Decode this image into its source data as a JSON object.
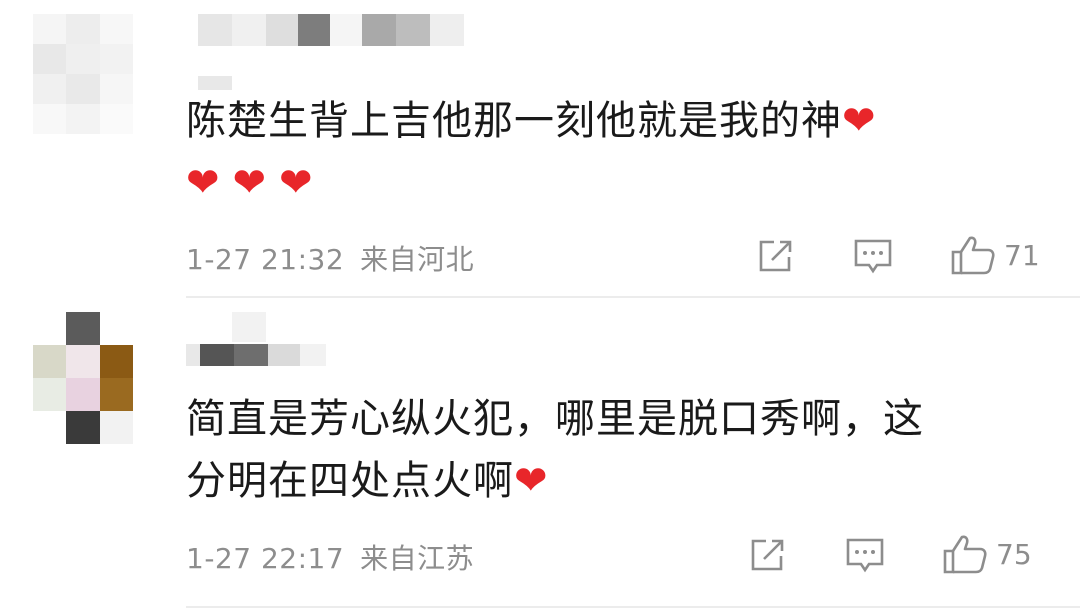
{
  "comments": [
    {
      "text": "陈楚生背上吉他那一刻他就是我的神",
      "hearts": [
        "❤",
        "❤",
        "❤",
        "❤"
      ],
      "time": "1-27 21:32",
      "location": "来自河北",
      "likes": "71"
    },
    {
      "text_line1": "简直是芳心纵火犯，哪里是脱口秀啊，这",
      "text_line2": "分明在四处点火啊",
      "hearts": [
        "❤"
      ],
      "time": "1-27 22:17",
      "location": "来自江苏",
      "likes": "75"
    }
  ],
  "icons": {
    "share": "share-icon",
    "comment": "comment-icon",
    "like": "thumbs-up-icon"
  },
  "colors": {
    "text": "#1a1a1a",
    "meta": "#8d8d8d",
    "heart": "#e8262a",
    "divider": "#ececec"
  }
}
